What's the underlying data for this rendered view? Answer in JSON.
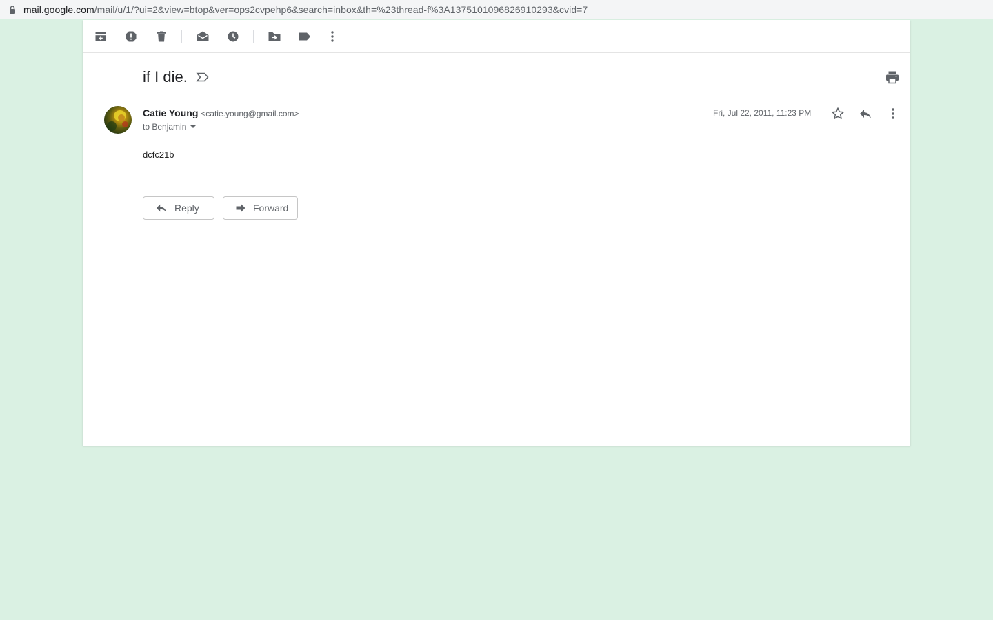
{
  "browser": {
    "url_host": "mail.google.com",
    "url_path": "/mail/u/1/?ui=2&view=btop&ver=ops2cvpehp6&search=inbox&th=%23thread-f%3A1375101096826910293&cvid=7"
  },
  "toolbar": {
    "icons": [
      "archive-icon",
      "report-spam-icon",
      "delete-icon",
      "mark-unread-icon",
      "snooze-icon",
      "move-to-icon",
      "label-icon",
      "more-vert-icon"
    ]
  },
  "message": {
    "subject": "if I die.",
    "sender_name": "Catie Young",
    "sender_email": "<catie.young@gmail.com>",
    "recipient": "to Benjamin",
    "date": "Fri, Jul 22, 2011, 11:23 PM",
    "body": "dcfc21b"
  },
  "actions": {
    "reply_label": "Reply",
    "forward_label": "Forward"
  },
  "colors": {
    "background": "#daf1e3",
    "icon": "#5f6368"
  }
}
